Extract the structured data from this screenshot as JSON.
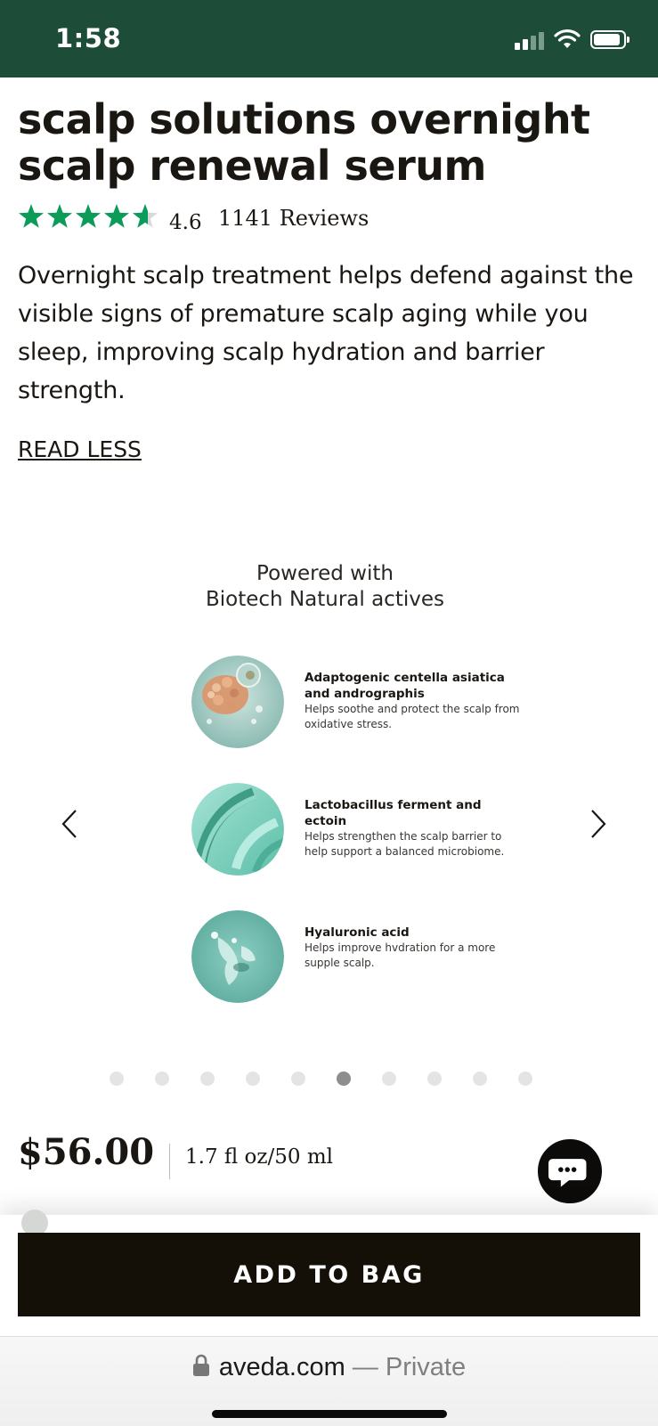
{
  "status_bar": {
    "time": "1:58",
    "cellular_icon": "cellular-signal-icon",
    "wifi_icon": "wifi-icon",
    "battery_icon": "battery-icon",
    "battery_level": 0.85,
    "background_color": "#1d4d39"
  },
  "product": {
    "title": "scalp solutions overnight scalp renewal serum",
    "rating": {
      "stars": 4.6,
      "value": "4.6",
      "reviews": "1141 Reviews",
      "star_color": "#0c9b58"
    },
    "description": "Overnight scalp treatment helps defend against the visible signs of premature scalp aging while you sleep, improving scalp hydration and barrier strength.",
    "read_less_label": "READ LESS"
  },
  "carousel": {
    "heading_line1": "Powered with",
    "heading_line2": "Biotech Natural actives",
    "prev_icon": "chevron-left-icon",
    "next_icon": "chevron-right-icon",
    "actives": [
      {
        "name": "Adaptogenic centella asiatica and andrographis",
        "description": "Helps soothe and protect the scalp from oxidative stress."
      },
      {
        "name": "Lactobacillus ferment and ectoin",
        "description": "Helps strengthen the scalp barrier to help support a balanced microbiome."
      },
      {
        "name": "Hyaluronic acid",
        "description": "Helps improve hvdration for a more supple scalp."
      }
    ],
    "slide_count": 10,
    "active_slide": 6
  },
  "purchase": {
    "price": "$56.00",
    "size": "1.7 fl oz/50 ml",
    "chat_icon": "chat-bubble-icon",
    "add_to_bag_label": "ADD TO BAG"
  },
  "browser": {
    "lock_icon": "lock-icon",
    "domain": "aveda.com",
    "separator": " — ",
    "privacy": "Private"
  }
}
